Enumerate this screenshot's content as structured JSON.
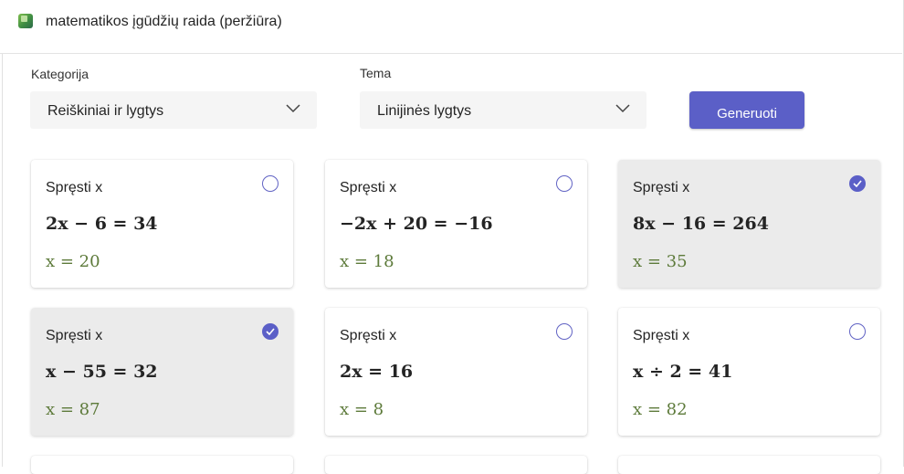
{
  "app": {
    "title": "matematikos įgūdžių raida (peržiūra)",
    "icon": "app-logo-icon"
  },
  "filters": {
    "category_label": "Kategorija",
    "category_value": "Reiškiniai ir lygtys",
    "topic_label": "Tema",
    "topic_value": "Linijinės lygtys",
    "generate_label": "Generuoti"
  },
  "colors": {
    "accent": "#5b5fc7",
    "answer": "#5d7a3a",
    "selected_card": "#ebebeb"
  },
  "cards": [
    {
      "title": "Spręsti x",
      "equation": "2x − 6 = 34",
      "answer": "x = 20",
      "selected": false
    },
    {
      "title": "Spręsti x",
      "equation": "−2x + 20 = −16",
      "answer": "x = 18",
      "selected": false
    },
    {
      "title": "Spręsti x",
      "equation": "8x − 16 = 264",
      "answer": "x = 35",
      "selected": true
    },
    {
      "title": "Spręsti x",
      "equation": "x − 55 = 32",
      "answer": "x = 87",
      "selected": true
    },
    {
      "title": "Spręsti x",
      "equation": "2x = 16",
      "answer": "x = 8",
      "selected": false
    },
    {
      "title": "Spręsti x",
      "equation": "x ÷ 2 = 41",
      "answer": "x = 82",
      "selected": false
    }
  ]
}
